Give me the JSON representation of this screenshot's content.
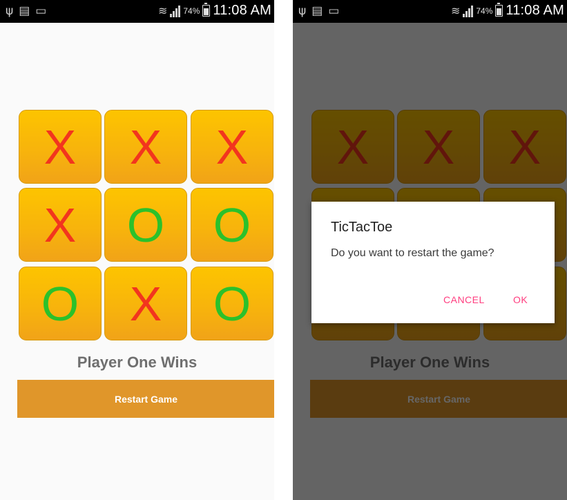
{
  "status_bar": {
    "icons": [
      "usb-icon",
      "keyboard-off-icon",
      "image-icon"
    ],
    "battery": "74%",
    "time": "11:08 AM"
  },
  "game": {
    "board": [
      "X",
      "X",
      "X",
      "X",
      "O",
      "O",
      "O",
      "X",
      "O"
    ],
    "result": "Player One Wins",
    "restart_label": "Restart Game"
  },
  "dialog": {
    "title": "TicTacToe",
    "message": "Do you want to restart the game?",
    "cancel_label": "CANCEL",
    "ok_label": "OK"
  },
  "colors": {
    "tile_top": "#fdc400",
    "tile_bottom": "#f1a318",
    "x_mark": "#f2351e",
    "o_mark": "#2bc12b",
    "button": "#e0962a",
    "dialog_accent": "#ff3d7f"
  }
}
